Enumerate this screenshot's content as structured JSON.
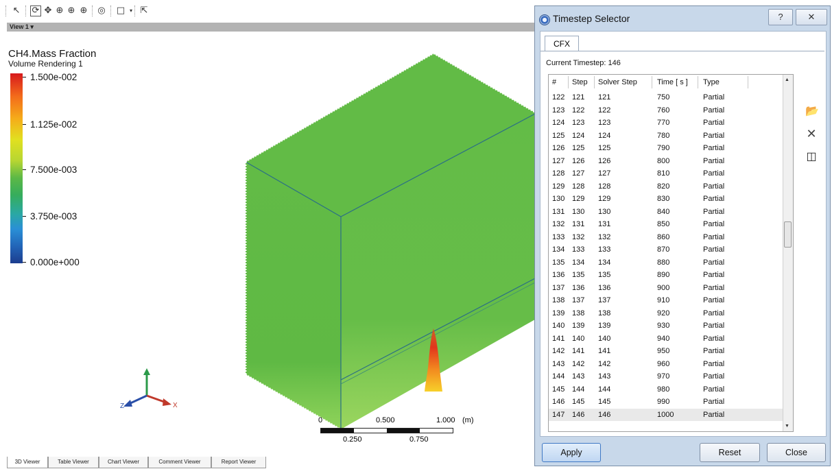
{
  "toolbar": {
    "view_label": "View 1",
    "icons": [
      "select-icon",
      "rotate-icon",
      "pan-icon",
      "zoom-icon",
      "zoom-box-icon",
      "zoom-fit-icon",
      "fit-view-icon",
      "layout-icon",
      "probe-icon"
    ]
  },
  "legend": {
    "variable": "CH4.Mass Fraction",
    "subtitle": "Volume Rendering 1",
    "ticks": [
      "1.500e-002",
      "1.125e-002",
      "7.500e-003",
      "3.750e-003",
      "0.000e+000"
    ]
  },
  "ruler": {
    "top_labels": [
      "0",
      "0.500",
      "1.000"
    ],
    "unit": "(m)",
    "bottom_labels": [
      "0.250",
      "0.750"
    ]
  },
  "axes": {
    "y": "Y",
    "z": "Z",
    "x": "X"
  },
  "tabs": [
    "3D Viewer",
    "Table Viewer",
    "Chart Viewer",
    "Comment Viewer",
    "Report Viewer"
  ],
  "dialog": {
    "title": "Timestep Selector",
    "help_label": "?",
    "close_label": "✕",
    "tab": "CFX",
    "current_timestep": "Current Timestep: 146",
    "columns": [
      "#",
      "Step",
      "Solver Step",
      "Time [ s ]",
      "Type"
    ],
    "rows": [
      [
        "122",
        "121",
        "121",
        "750",
        "Partial"
      ],
      [
        "123",
        "122",
        "122",
        "760",
        "Partial"
      ],
      [
        "124",
        "123",
        "123",
        "770",
        "Partial"
      ],
      [
        "125",
        "124",
        "124",
        "780",
        "Partial"
      ],
      [
        "126",
        "125",
        "125",
        "790",
        "Partial"
      ],
      [
        "127",
        "126",
        "126",
        "800",
        "Partial"
      ],
      [
        "128",
        "127",
        "127",
        "810",
        "Partial"
      ],
      [
        "129",
        "128",
        "128",
        "820",
        "Partial"
      ],
      [
        "130",
        "129",
        "129",
        "830",
        "Partial"
      ],
      [
        "131",
        "130",
        "130",
        "840",
        "Partial"
      ],
      [
        "132",
        "131",
        "131",
        "850",
        "Partial"
      ],
      [
        "133",
        "132",
        "132",
        "860",
        "Partial"
      ],
      [
        "134",
        "133",
        "133",
        "870",
        "Partial"
      ],
      [
        "135",
        "134",
        "134",
        "880",
        "Partial"
      ],
      [
        "136",
        "135",
        "135",
        "890",
        "Partial"
      ],
      [
        "137",
        "136",
        "136",
        "900",
        "Partial"
      ],
      [
        "138",
        "137",
        "137",
        "910",
        "Partial"
      ],
      [
        "139",
        "138",
        "138",
        "920",
        "Partial"
      ],
      [
        "140",
        "139",
        "139",
        "930",
        "Partial"
      ],
      [
        "141",
        "140",
        "140",
        "940",
        "Partial"
      ],
      [
        "142",
        "141",
        "141",
        "950",
        "Partial"
      ],
      [
        "143",
        "142",
        "142",
        "960",
        "Partial"
      ],
      [
        "144",
        "143",
        "143",
        "970",
        "Partial"
      ],
      [
        "145",
        "144",
        "144",
        "980",
        "Partial"
      ],
      [
        "146",
        "145",
        "145",
        "990",
        "Partial"
      ],
      [
        "147",
        "146",
        "146",
        "1000",
        "Partial"
      ]
    ],
    "selected_row": 25,
    "buttons": {
      "apply": "Apply",
      "reset": "Reset",
      "close": "Close"
    }
  }
}
